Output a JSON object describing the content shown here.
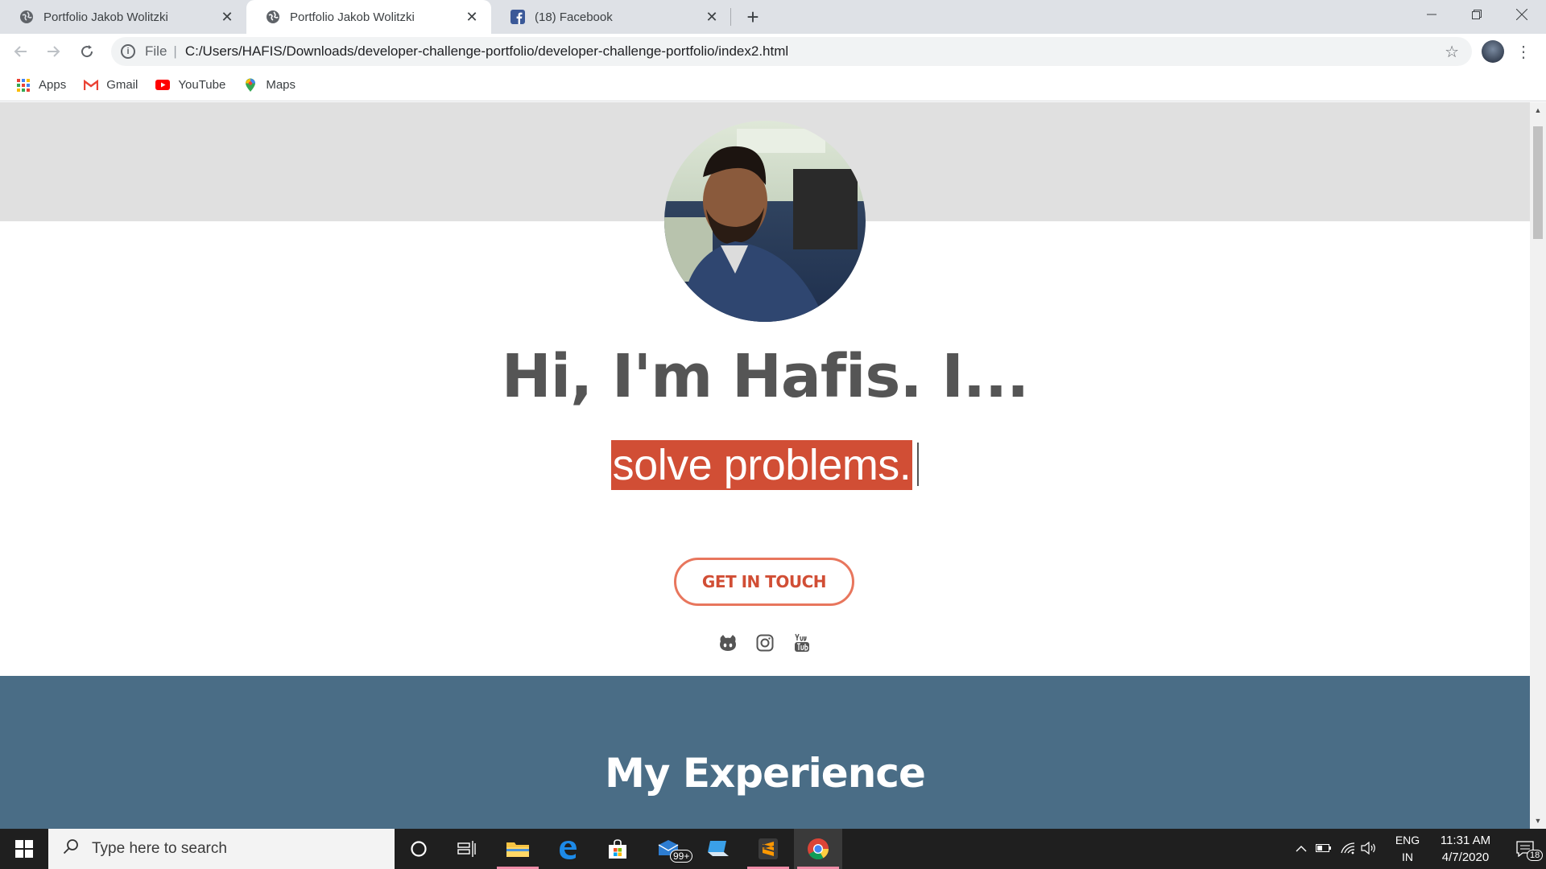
{
  "browser": {
    "tabs": [
      {
        "title": "Portfolio Jakob Wolitzki",
        "icon": "globe-icon",
        "active": false
      },
      {
        "title": "Portfolio Jakob Wolitzki",
        "icon": "globe-icon",
        "active": true
      },
      {
        "title": "(18) Facebook",
        "icon": "facebook-icon",
        "active": false
      }
    ],
    "close_glyph": "✕",
    "new_tab_glyph": "+",
    "omnibox": {
      "scheme_label": "File",
      "url": "C:/Users/HAFIS/Downloads/developer-challenge-portfolio/developer-challenge-portfolio/index2.html"
    },
    "bookmarks": [
      {
        "label": "Apps",
        "icon": "apps-grid-icon"
      },
      {
        "label": "Gmail",
        "icon": "gmail-icon"
      },
      {
        "label": "YouTube",
        "icon": "youtube-icon"
      },
      {
        "label": "Maps",
        "icon": "maps-pin-icon"
      }
    ]
  },
  "page": {
    "hero_title": "Hi, I'm Hafis. I...",
    "typed_text": "solve problems.",
    "cta_label": "GET IN TOUCH",
    "social_icons": [
      "github-icon",
      "instagram-icon",
      "youtube-icon"
    ],
    "experience_title": "My Experience"
  },
  "taskbar": {
    "search_placeholder": "Type here to search",
    "store_badge": "99+",
    "language": "ENG",
    "region": "IN",
    "time": "11:31 AM",
    "date": "4/7/2020",
    "notification_count": "18"
  },
  "colors": {
    "accent": "#d14e35",
    "cta_border": "#e8765d",
    "experience_bg": "#4a6d86",
    "hero_top_bg": "#e0e0e0",
    "heading": "#555555"
  }
}
